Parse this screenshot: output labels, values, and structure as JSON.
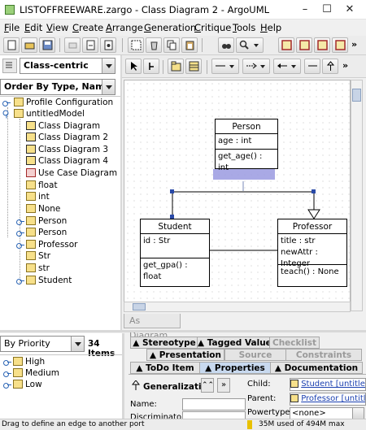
{
  "window": {
    "title": "LISTOFFREEWARE.zargo - Class Diagram 2 - ArgoUML"
  },
  "menu": [
    "File",
    "Edit",
    "View",
    "Create",
    "Arrange",
    "Generation",
    "Critique",
    "Tools",
    "Help"
  ],
  "explorer": {
    "perspective": "Class-centric",
    "ordering": "Order By Type, Name",
    "tree": [
      {
        "label": "Profile Configuration",
        "icon": "folder-icon"
      },
      {
        "label": "untitledModel",
        "icon": "folder-icon"
      },
      {
        "label": "Class Diagram",
        "icon": "class-diagram-icon"
      },
      {
        "label": "Class Diagram 2",
        "icon": "class-diagram-icon"
      },
      {
        "label": "Class Diagram 3",
        "icon": "class-diagram-icon"
      },
      {
        "label": "Class Diagram 4",
        "icon": "class-diagram-icon"
      },
      {
        "label": "Use Case Diagram",
        "icon": "usecase-diagram-icon"
      },
      {
        "label": "float",
        "icon": "datatype-icon"
      },
      {
        "label": "int",
        "icon": "datatype-icon"
      },
      {
        "label": "None",
        "icon": "datatype-icon"
      },
      {
        "label": "Person",
        "icon": "class-icon"
      },
      {
        "label": "Person",
        "icon": "class-icon"
      },
      {
        "label": "Professor",
        "icon": "class-icon"
      },
      {
        "label": "Str",
        "icon": "datatype-icon"
      },
      {
        "label": "str",
        "icon": "datatype-icon"
      },
      {
        "label": "Student",
        "icon": "class-icon"
      }
    ]
  },
  "diagram": {
    "tab_label": "As Diagram",
    "classes": {
      "person": {
        "name": "Person",
        "attrs": [
          "age : int"
        ],
        "ops": [
          "get_age() : int"
        ]
      },
      "student": {
        "name": "Student",
        "attrs": [
          "id : Str"
        ],
        "ops": [
          "get_gpa() : float"
        ]
      },
      "professor": {
        "name": "Professor",
        "attrs": [
          "title : str",
          "newAttr : Integer"
        ],
        "ops": [
          "teach() : None"
        ]
      }
    }
  },
  "todo": {
    "sort": "By Priority",
    "count": "34 Items",
    "items": [
      "High",
      "Medium",
      "Low"
    ]
  },
  "properties": {
    "tabs_row1": [
      "Stereotype",
      "Tagged Values",
      "Checklist"
    ],
    "tabs_row2": [
      "Presentation",
      "Source",
      "Constraints"
    ],
    "tabs_row3": [
      "ToDo Item",
      "Properties",
      "Documentation"
    ],
    "element_type": "Generalization",
    "name_label": "Name:",
    "discriminator_label": "Discriminator:",
    "child_label": "Child:",
    "child_value": "Student [untitled]",
    "parent_label": "Parent:",
    "parent_value": "Professor [untitle",
    "powertype_label": "Powertype:",
    "powertype_value": "<none>"
  },
  "status": {
    "message": "Drag to define an edge to another port",
    "memory": "35M used of 494M max"
  }
}
